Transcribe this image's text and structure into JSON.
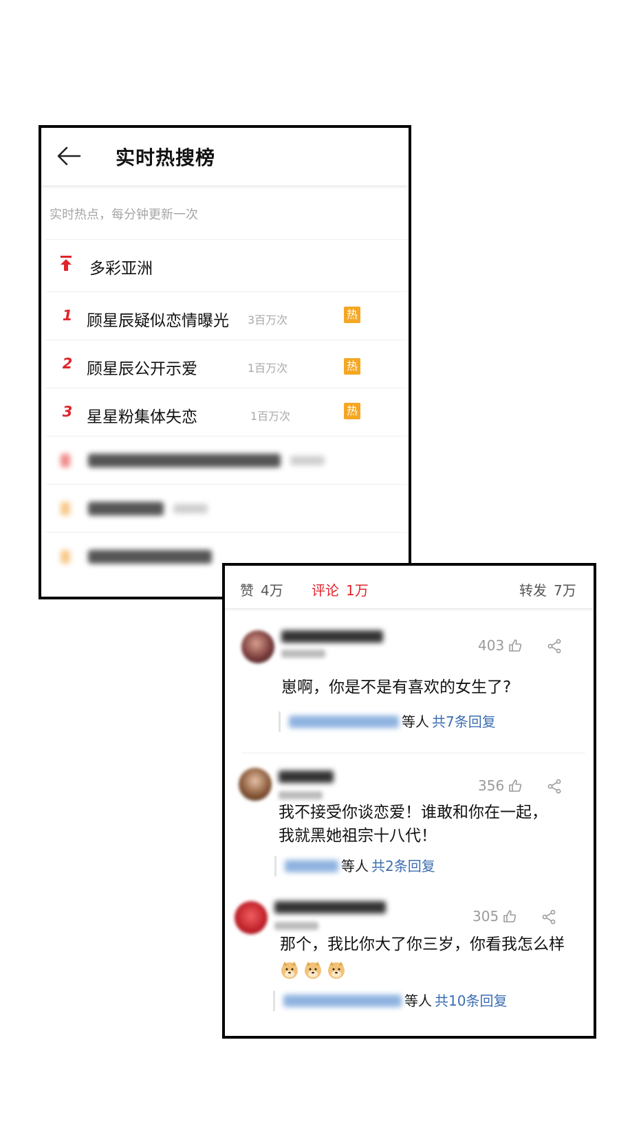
{
  "hot_search": {
    "title": "实时热搜榜",
    "subtitle": "实时热点，每分钟更新一次",
    "pinned": "多彩亚洲",
    "items": [
      {
        "rank": "1",
        "keyword": "顾星辰疑似恋情曝光",
        "count": "3百万次",
        "badge": "热"
      },
      {
        "rank": "2",
        "keyword": "顾星辰公开示爱",
        "count": "1百万次",
        "badge": "热"
      },
      {
        "rank": "3",
        "keyword": "星星粉集体失恋",
        "count": "1百万次",
        "badge": "热"
      }
    ]
  },
  "comments_panel": {
    "tabs": {
      "likes_label": "赞",
      "likes_count": "4万",
      "comments_label": "评论",
      "comments_count": "1万",
      "reposts_label": "转发",
      "reposts_count": "7万"
    },
    "comments": [
      {
        "likes": "403",
        "text": "崽啊，你是不是有喜欢的女生了?",
        "replies_suffix": "等人",
        "replies_count": "共7条回复"
      },
      {
        "likes": "356",
        "text_line1": "我不接受你谈恋爱！谁敢和你在一起，",
        "text_line2": "我就黑她祖宗十八代！",
        "replies_suffix": "等人",
        "replies_count": "共2条回复"
      },
      {
        "likes": "305",
        "text": "那个，我比你大了你三岁，你看我怎么样",
        "replies_suffix": "等人",
        "replies_count": "共10条回复"
      }
    ]
  },
  "colors": {
    "accent_red": "#e0242b",
    "hot_badge": "#f5a623",
    "link_blue": "#3b6db1"
  },
  "icons": [
    "back-arrow-icon",
    "pin-top-icon",
    "thumb-up-icon",
    "share-icon",
    "doge-emoji-icon"
  ]
}
